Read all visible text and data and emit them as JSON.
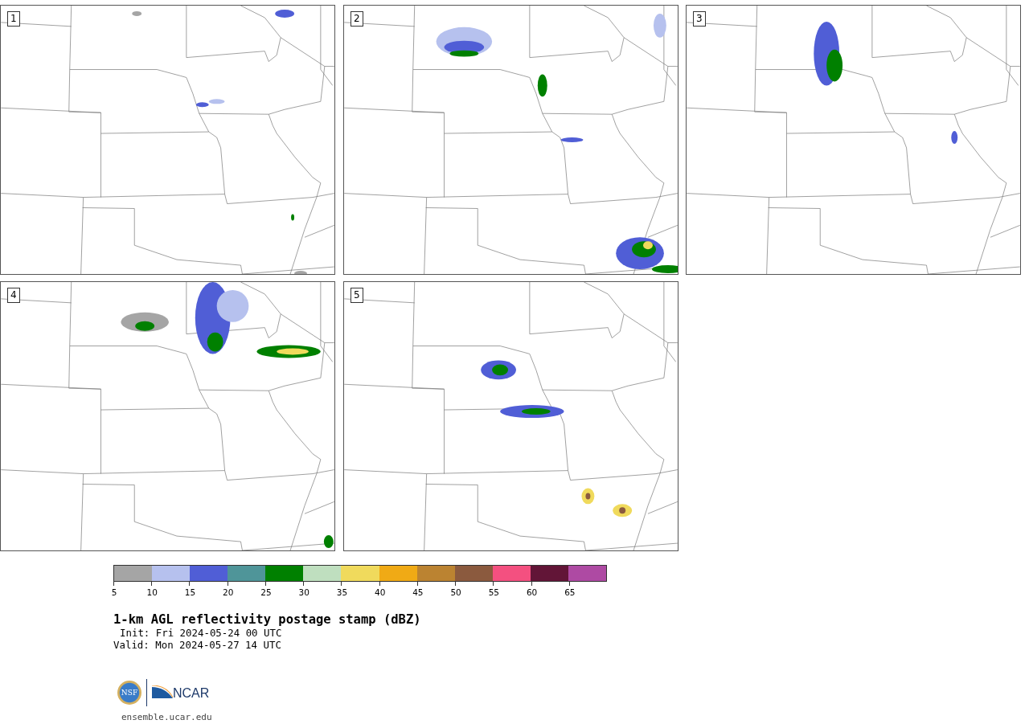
{
  "panels": [
    {
      "label": "1"
    },
    {
      "label": "2"
    },
    {
      "label": "3"
    },
    {
      "label": "4"
    },
    {
      "label": "5"
    }
  ],
  "colorbar": {
    "segments": [
      {
        "color": "#a5a5a5",
        "label": "5"
      },
      {
        "color": "#b6c1ee",
        "label": "10"
      },
      {
        "color": "#505ed6",
        "label": "15"
      },
      {
        "color": "#4f9599",
        "label": "20"
      },
      {
        "color": "#008000",
        "label": "25"
      },
      {
        "color": "#bfdfbf",
        "label": "30"
      },
      {
        "color": "#f0da5c",
        "label": "35"
      },
      {
        "color": "#f0aa15",
        "label": "40"
      },
      {
        "color": "#bb8331",
        "label": "45"
      },
      {
        "color": "#8b5a3e",
        "label": "50"
      },
      {
        "color": "#f45080",
        "label": "55"
      },
      {
        "color": "#621537",
        "label": "60"
      },
      {
        "color": "#ae4aa3",
        "label": "65"
      }
    ]
  },
  "title": "1-km AGL reflectivity postage stamp (dBZ)",
  "init": "Init: Fri 2024-05-24 00 UTC",
  "valid": "Valid: Mon 2024-05-27 14 UTC",
  "logos": {
    "nsf": "NSF",
    "ncar": "NCAR"
  },
  "url": "ensemble.ucar.edu"
}
